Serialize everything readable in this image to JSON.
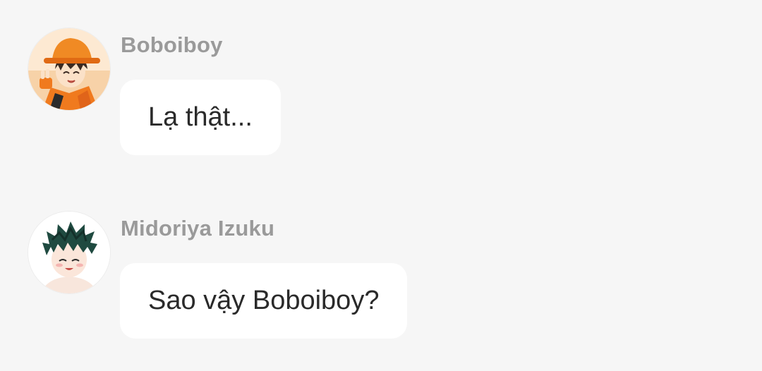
{
  "messages": [
    {
      "sender": "Boboiboy",
      "text": "Lạ thật...",
      "avatar_icon": "boboiboy-avatar"
    },
    {
      "sender": "Midoriya Izuku",
      "text": "Sao vậy Boboiboy?",
      "avatar_icon": "midoriya-avatar"
    }
  ],
  "colors": {
    "background": "#f6f6f6",
    "bubble": "#ffffff",
    "sender_name": "#9a9a9a",
    "message_text": "#2a2a2a"
  }
}
